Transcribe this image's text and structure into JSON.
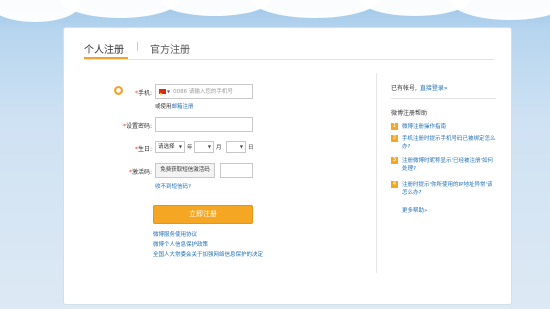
{
  "tabs": {
    "personal": "个人注册",
    "official": "官方注册",
    "sep": "|"
  },
  "form": {
    "phone_label": "手机:",
    "phone_icon": "circle-icon",
    "country_code": "0086",
    "phone_placeholder": "请输入您的手机号",
    "email_prefix": "或使用",
    "email_link": "邮箱注册",
    "password_label": "设置密码:",
    "birthday_label": "生日:",
    "year_value": "请选择",
    "year_unit": "年",
    "month_unit": "月",
    "day_unit": "日",
    "code_label": "激活码:",
    "code_button": "免费获取短信激活码",
    "code_help": "收不到短信码?",
    "submit": "立即注册",
    "required_mark": "*"
  },
  "footer_links": [
    "微博服务使用协议",
    "微博个人信息保护政策",
    "全国人大常委会关于加强网络信息保护的决定"
  ],
  "side": {
    "have_account": "已有帐号,",
    "login_link": "直接登录»",
    "help_title": "微博注册帮助",
    "faq": [
      {
        "num": "1",
        "text": "微博注册操作指南"
      },
      {
        "num": "2",
        "text": "手机注册时提示手机号码已被绑定怎么办?"
      },
      {
        "num": "3",
        "text": "注册微博时昵称显示'已经被注册'如何处理?"
      },
      {
        "num": "4",
        "text": "注册时提示'你所使用的IP地址异常'该怎么办?"
      }
    ],
    "more": "更多帮助»"
  },
  "colors": {
    "accent": "#f5a623",
    "link": "#1f6fb5",
    "background": "#cfe2f3"
  }
}
